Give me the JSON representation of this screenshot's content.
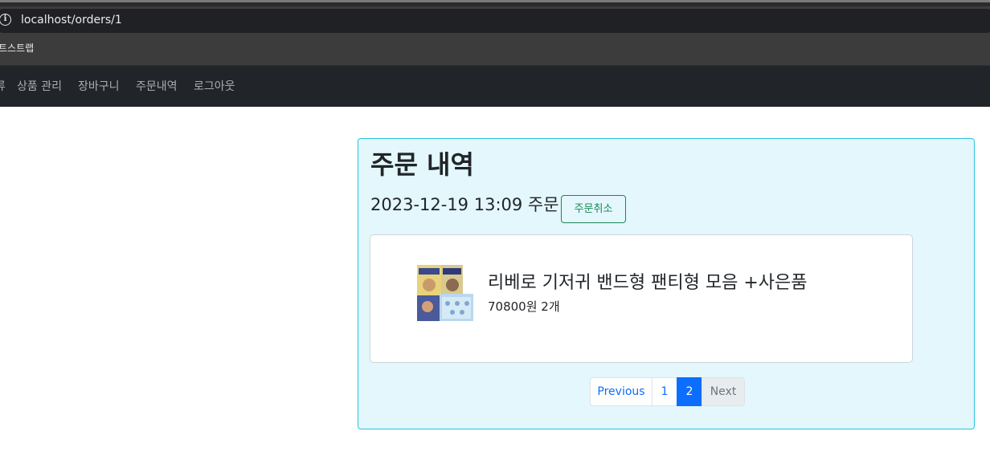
{
  "browser": {
    "url": "localhost/orders/1",
    "bookmark_label": "트스트랩"
  },
  "navbar": {
    "items": [
      {
        "label": "류"
      },
      {
        "label": "상품 관리"
      },
      {
        "label": "장바구니"
      },
      {
        "label": "주문내역"
      },
      {
        "label": "로그아웃"
      }
    ]
  },
  "order": {
    "title": "주문 내역",
    "date_label": "2023-12-19 13:09 주문",
    "cancel_label": "주문취소",
    "item": {
      "name": "리베로 기저귀 밴드형 팬티형 모음 +사은품",
      "meta": "70800원 2개",
      "image_icon": "diaper-package-image"
    }
  },
  "pagination": {
    "previous_label": "Previous",
    "pages": [
      "1",
      "2"
    ],
    "current_page": "2",
    "next_label": "Next"
  },
  "colors": {
    "navbar_bg": "#212529",
    "card_bg": "#e3f7fc",
    "card_border": "#2bc4df",
    "success": "#198754",
    "primary": "#0d6efd"
  }
}
